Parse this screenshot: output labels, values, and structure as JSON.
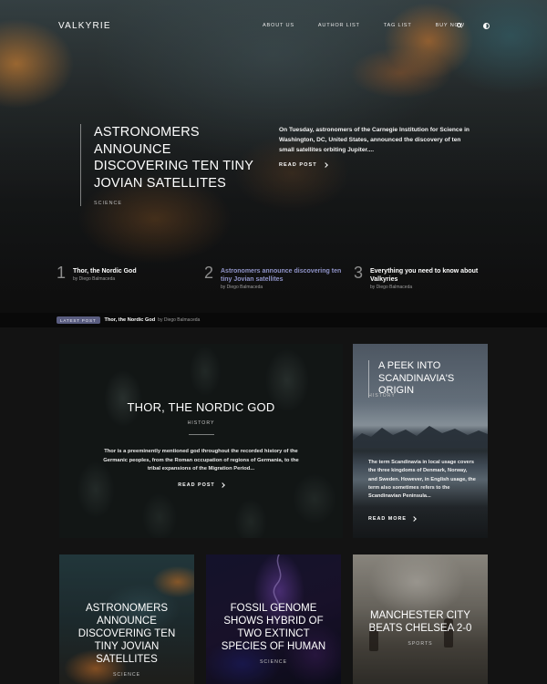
{
  "site": {
    "logo": "VALKYRIE"
  },
  "nav": {
    "links": [
      "ABOUT US",
      "AUTHOR LIST",
      "TAG LIST",
      "BUY NOW"
    ],
    "icons": [
      "search-icon",
      "theme-toggle-icon"
    ]
  },
  "hero": {
    "title": "ASTRONOMERS ANNOUNCE DISCOVERING TEN TINY JOVIAN SATELLITES",
    "category": "SCIENCE",
    "excerpt": "On Tuesday, astronomers of the Carnegie Institution for Science in Washington, DC, United States, announced the discovery of ten small satellites orbiting Jupiter....",
    "read_more": "READ POST",
    "list": [
      {
        "number": "1",
        "title": "Thor, the Nordic God",
        "by": "by",
        "author": "Diego Balmaceda"
      },
      {
        "number": "2",
        "title": "Astronomers announce discovering ten tiny Jovian satellites",
        "by": "by",
        "author": "Diego Balmaceda"
      },
      {
        "number": "3",
        "title": "Everything you need to know about Valkyries",
        "by": "by",
        "author": "Diego Balmaceda"
      }
    ]
  },
  "latest": {
    "badge": "LATEST POST",
    "title": "Thor, the Nordic God",
    "by": "by Diego Balmaceda"
  },
  "cards": {
    "thor": {
      "title": "THOR, THE NORDIC GOD",
      "category": "HISTORY",
      "excerpt": "Thor is a preeminently mentioned god throughout the recorded history of the Germanic peoples, from the Roman occupation of regions of Germania, to the tribal expansions of the Migration Period...",
      "read_more": "READ POST"
    },
    "scandinavia": {
      "title": "A PEEK INTO SCANDINAVIA'S ORIGIN",
      "category": "HISTORY",
      "excerpt": "The term Scandinavia in local usage covers the three kingdoms of Denmark, Norway, and Sweden. However, in English usage, the term also sometimes refers to the Scandinavian Peninsula...",
      "read_more": "READ MORE"
    },
    "astronomers": {
      "title": "ASTRONOMERS ANNOUNCE DISCOVERING TEN TINY JOVIAN SATELLITES",
      "category": "SCIENCE"
    },
    "fossil": {
      "title": "FOSSIL GENOME SHOWS HYBRID OF TWO EXTINCT SPECIES OF HUMAN",
      "category": "SCIENCE"
    },
    "manchester": {
      "title": "MANCHESTER CITY BEATS CHELSEA 2-0",
      "category": "SPORTS"
    }
  },
  "colors": {
    "accent": "#8f93c8",
    "badge_bg": "#5a5d80",
    "page_bg": "#131313"
  }
}
